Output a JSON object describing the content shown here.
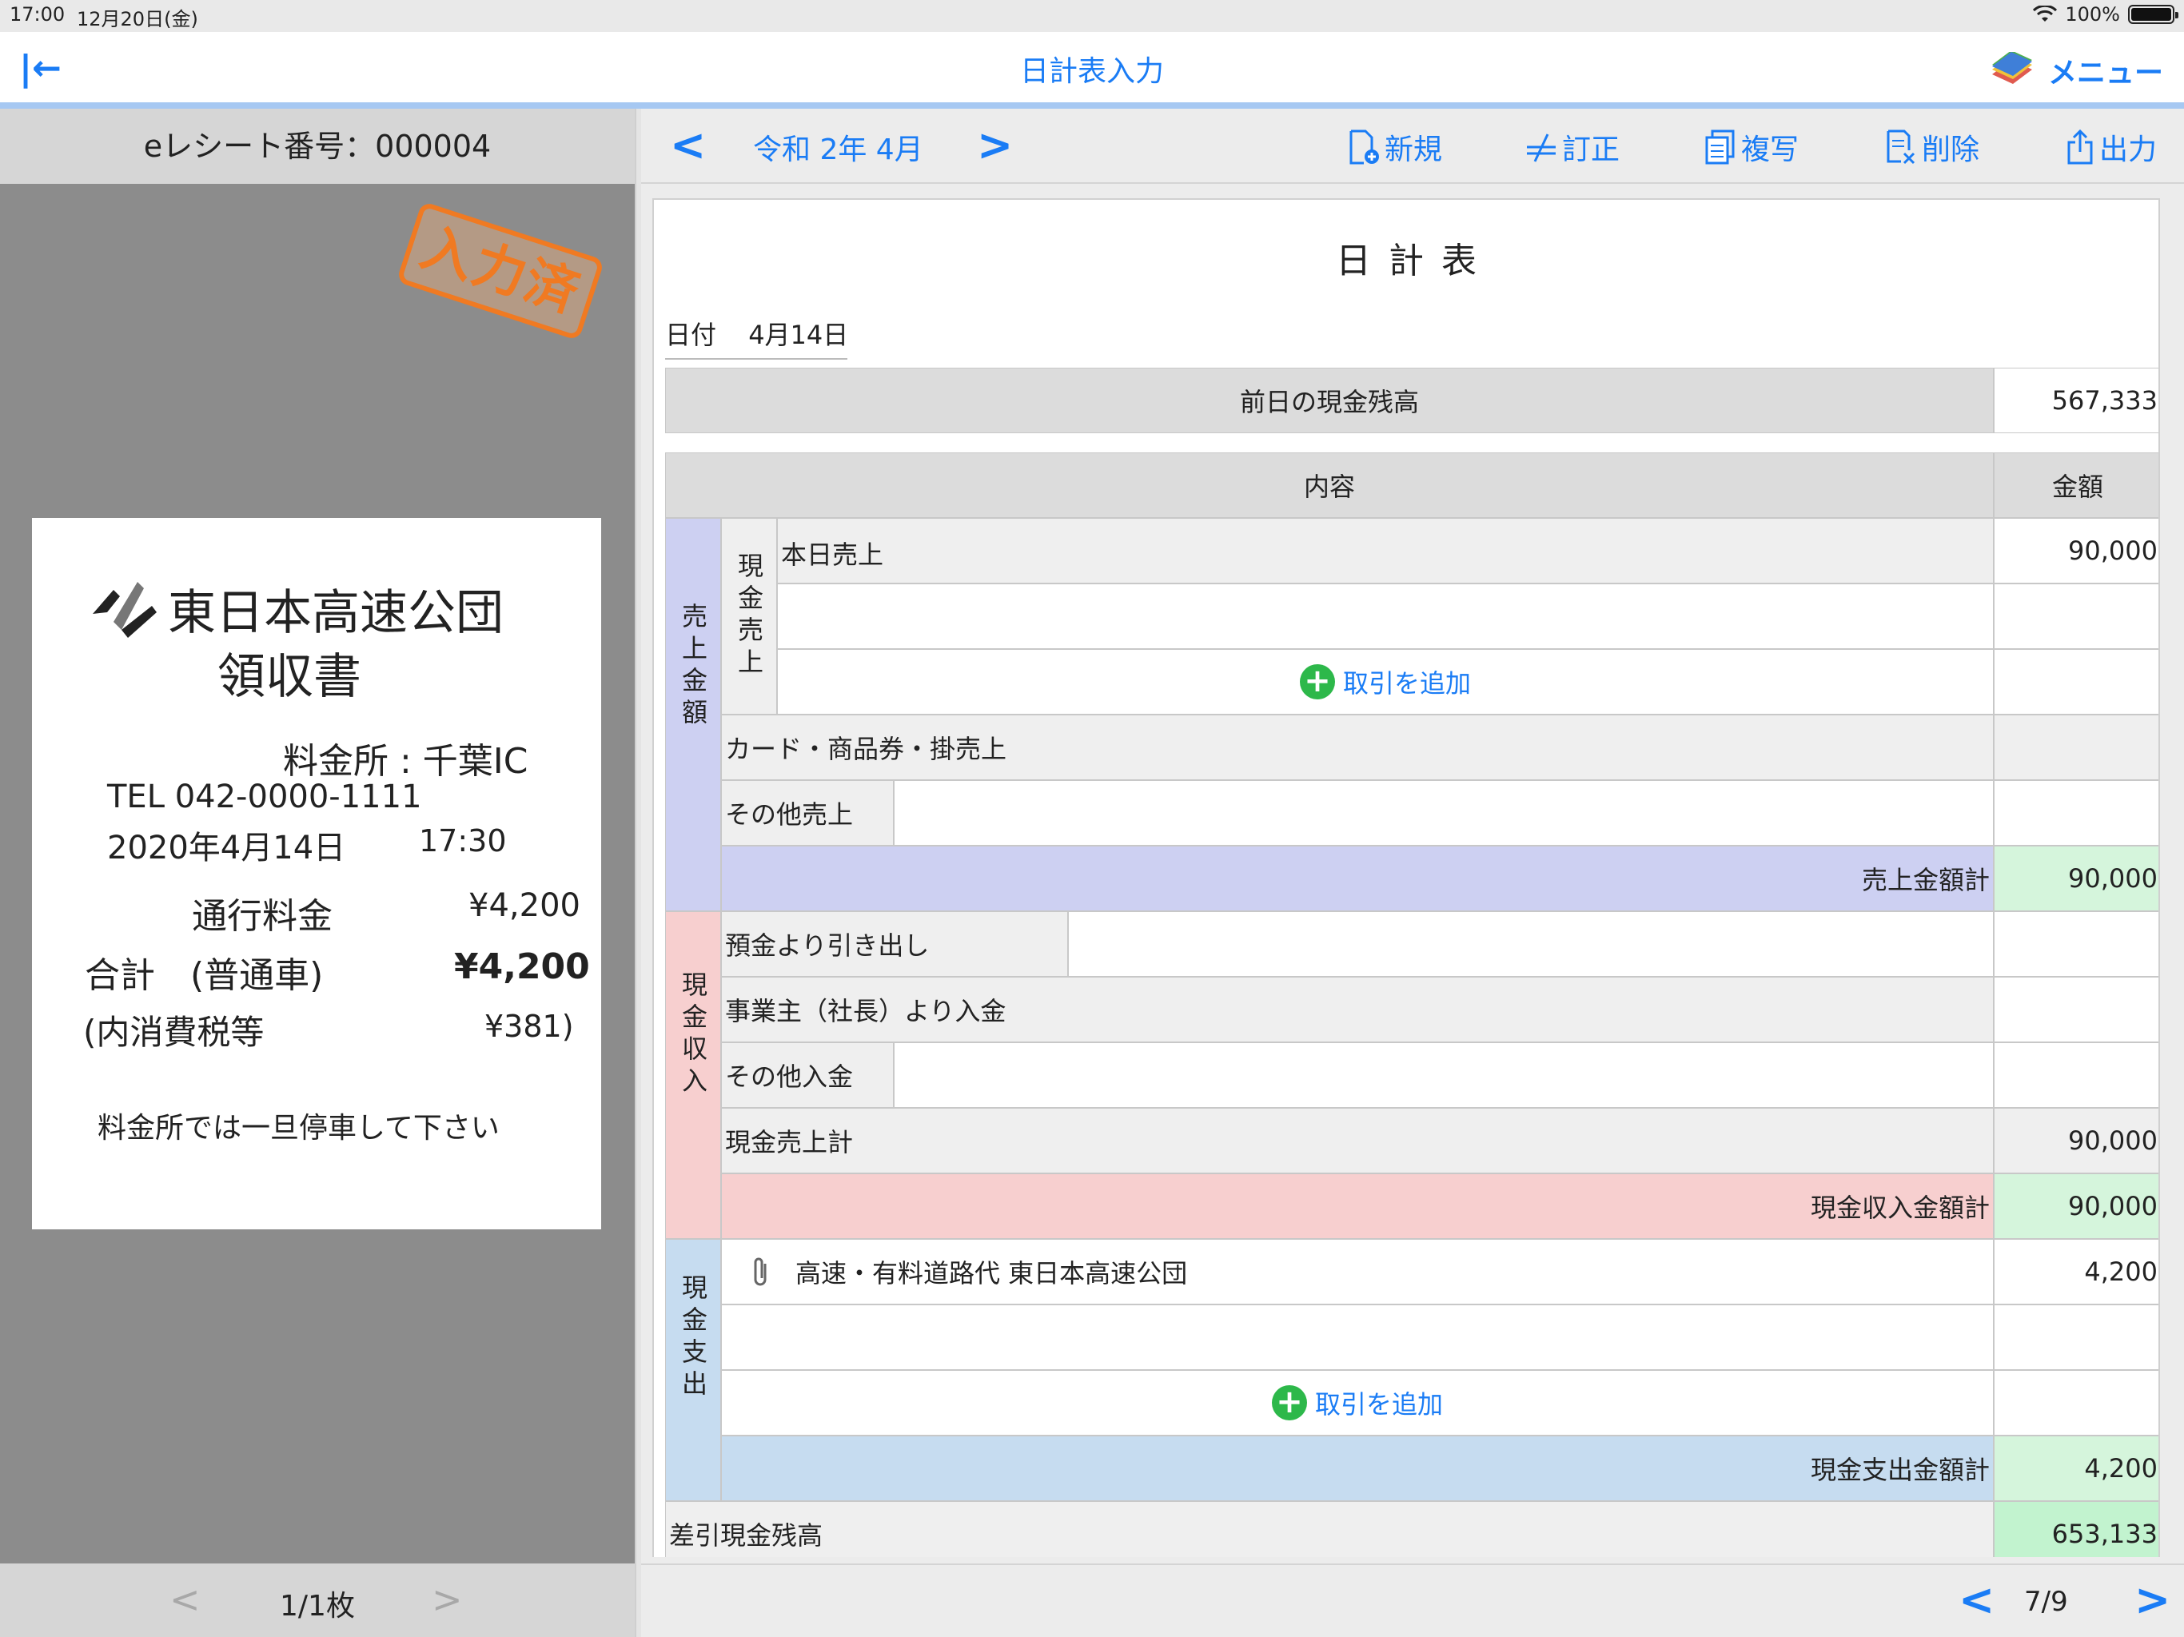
{
  "status_bar": {
    "time": "17:00",
    "date": "12月20日(金)",
    "battery": "100%"
  },
  "nav": {
    "title": "日計表入力",
    "menu_label": "メニュー",
    "back_icon": "collapse-left-icon",
    "menu_icon": "books-icon"
  },
  "receipt_panel": {
    "header": "eレシート番号：000004",
    "stamp": "入力済",
    "pager": "1/1枚"
  },
  "receipt": {
    "company": "東日本高速公団",
    "doc_title": "領収書",
    "toll_booth": "料金所 : 千葉IC",
    "tel": "TEL 042-0000-1111",
    "date": "2020年4月14日",
    "time": "17:30",
    "fee_label": "通行料金",
    "fee_value": "¥4,200",
    "total_label": "合計　(普通車)",
    "total_value": "¥4,200",
    "tax_label": "(内消費税等",
    "tax_value": "¥381)",
    "notice": "料金所では一旦停車して下さい"
  },
  "toolbar": {
    "period": "令和 2年 4月",
    "new_label": "新規",
    "edit_label": "訂正",
    "copy_label": "複写",
    "delete_label": "削除",
    "export_label": "出力"
  },
  "sheet": {
    "title": "日 計 表",
    "date_label": "日付",
    "date_value": "4月14日",
    "prev_balance_label": "前日の現金残高",
    "prev_balance_value": "567,333",
    "col_content": "内容",
    "col_amount": "金額",
    "sales_group": "売上金額",
    "cash_sales_group": "現金売上",
    "today_sales_label": "本日売上",
    "today_sales_value": "90,000",
    "add_transaction": "取引を追加",
    "card_sales_label": "カード・商品券・掛売上",
    "other_sales_label": "その他売上",
    "sales_total_label": "売上金額計",
    "sales_total_value": "90,000",
    "cash_income_group": "現金収入",
    "withdraw_label": "預金より引き出し",
    "owner_deposit_label": "事業主（社長）より入金",
    "other_income_label": "その他入金",
    "cash_sales_total_label": "現金売上計",
    "cash_sales_total_value": "90,000",
    "cash_income_total_label": "現金収入金額計",
    "cash_income_total_value": "90,000",
    "cash_expense_group": "現金支出",
    "expense_item_label": "高速・有料道路代 東日本高速公団",
    "expense_item_value": "4,200",
    "expense_total_label": "現金支出金額計",
    "expense_total_value": "4,200",
    "balance_label": "差引現金残高",
    "balance_value": "653,133"
  },
  "bottom_pager": "7/9"
}
